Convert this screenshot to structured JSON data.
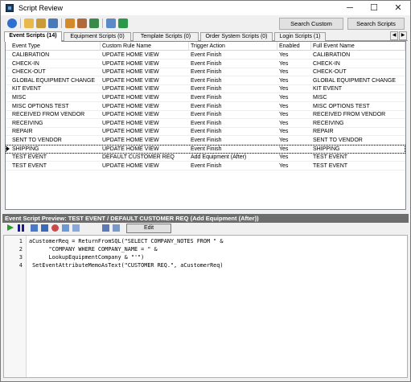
{
  "window": {
    "title": "Script Review",
    "minimize_glyph": "─",
    "maximize_glyph": "☐",
    "close_glyph": "✕"
  },
  "toolbar": {
    "icons": [
      "back-icon",
      "new-script-icon",
      "edit-script-icon",
      "script-view-icon",
      "import-icon",
      "export-icon",
      "refresh-icon",
      "compile-icon",
      "save-icon"
    ],
    "search_custom_reports_label": "Search Custom Reports",
    "search_scripts_label": "Search Scripts"
  },
  "tabs": [
    {
      "label": "Event Scripts (14)",
      "active": true
    },
    {
      "label": "Equipment Scripts (0)",
      "active": false
    },
    {
      "label": "Template Scripts (0)",
      "active": false
    },
    {
      "label": "Order System Scripts (0)",
      "active": false
    },
    {
      "label": "Login Scripts (1)",
      "active": false
    }
  ],
  "tab_scroll": {
    "left": "◀",
    "right": "▶"
  },
  "grid": {
    "columns": [
      "Event Type",
      "Custom Rule Name",
      "Trigger Action",
      "Enabled",
      "Full Event Name"
    ],
    "selected_index": 11,
    "rows": [
      [
        "CALIBRATION",
        "UPDATE HOME VIEW",
        "Event Finish",
        "Yes",
        "CALIBRATION"
      ],
      [
        "CHECK-IN",
        "UPDATE HOME VIEW",
        "Event Finish",
        "Yes",
        "CHECK-IN"
      ],
      [
        "CHECK-OUT",
        "UPDATE HOME VIEW",
        "Event Finish",
        "Yes",
        "CHECK-OUT"
      ],
      [
        "GLOBAL EQUIPMENT CHANGE",
        "UPDATE HOME VIEW",
        "Event Finish",
        "Yes",
        "GLOBAL EQUIPMENT CHANGE"
      ],
      [
        "KIT EVENT",
        "UPDATE HOME VIEW",
        "Event Finish",
        "Yes",
        "KIT EVENT"
      ],
      [
        "MISC",
        "UPDATE HOME VIEW",
        "Event Finish",
        "Yes",
        "MISC"
      ],
      [
        "MISC OPTIONS TEST",
        "UPDATE HOME VIEW",
        "Event Finish",
        "Yes",
        "MISC OPTIONS TEST"
      ],
      [
        "RECEIVED FROM VENDOR",
        "UPDATE HOME VIEW",
        "Event Finish",
        "Yes",
        "RECEIVED FROM VENDOR"
      ],
      [
        "RECEIVING",
        "UPDATE HOME VIEW",
        "Event Finish",
        "Yes",
        "RECEIVING"
      ],
      [
        "REPAIR",
        "UPDATE HOME VIEW",
        "Event Finish",
        "Yes",
        "REPAIR"
      ],
      [
        "SENT TO VENDOR",
        "UPDATE HOME VIEW",
        "Event Finish",
        "Yes",
        "SENT TO VENDOR"
      ],
      [
        "SHIPPING",
        "UPDATE HOME VIEW",
        "Event Finish",
        "Yes",
        "SHIPPING"
      ],
      [
        "TEST EVENT",
        "DEFAULT CUSTOMER REQ",
        "Add Equipment (After)",
        "Yes",
        "TEST EVENT"
      ],
      [
        "TEST EVENT",
        "UPDATE HOME VIEW",
        "Event Finish",
        "Yes",
        "TEST EVENT"
      ]
    ]
  },
  "preview": {
    "title": "Event Script Preview:  TEST EVENT / DEFAULT CUSTOMER REQ (Add Equipment (After))",
    "toolbar_icons": [
      "run-icon",
      "pause-icon",
      "step-icon",
      "step-over-icon",
      "breakpoint-icon",
      "watch-icon",
      "clear-icon",
      "tool-a-icon",
      "tool-b-icon"
    ],
    "edit_label": "Edit",
    "line_numbers": [
      "1",
      "2",
      "3",
      "4"
    ],
    "code_lines": [
      "aCustomerReq = ReturnFromSQL(\"SELECT COMPANY_NOTES FROM \" &",
      "      \"COMPANY WHERE COMPANY_NAME = \" &",
      "      LookupEquipmentCompany & \"'\")",
      " SetEventAttributeMemoAsText(\"CUSTOMER REQ.\", aCustomerReq)"
    ]
  }
}
